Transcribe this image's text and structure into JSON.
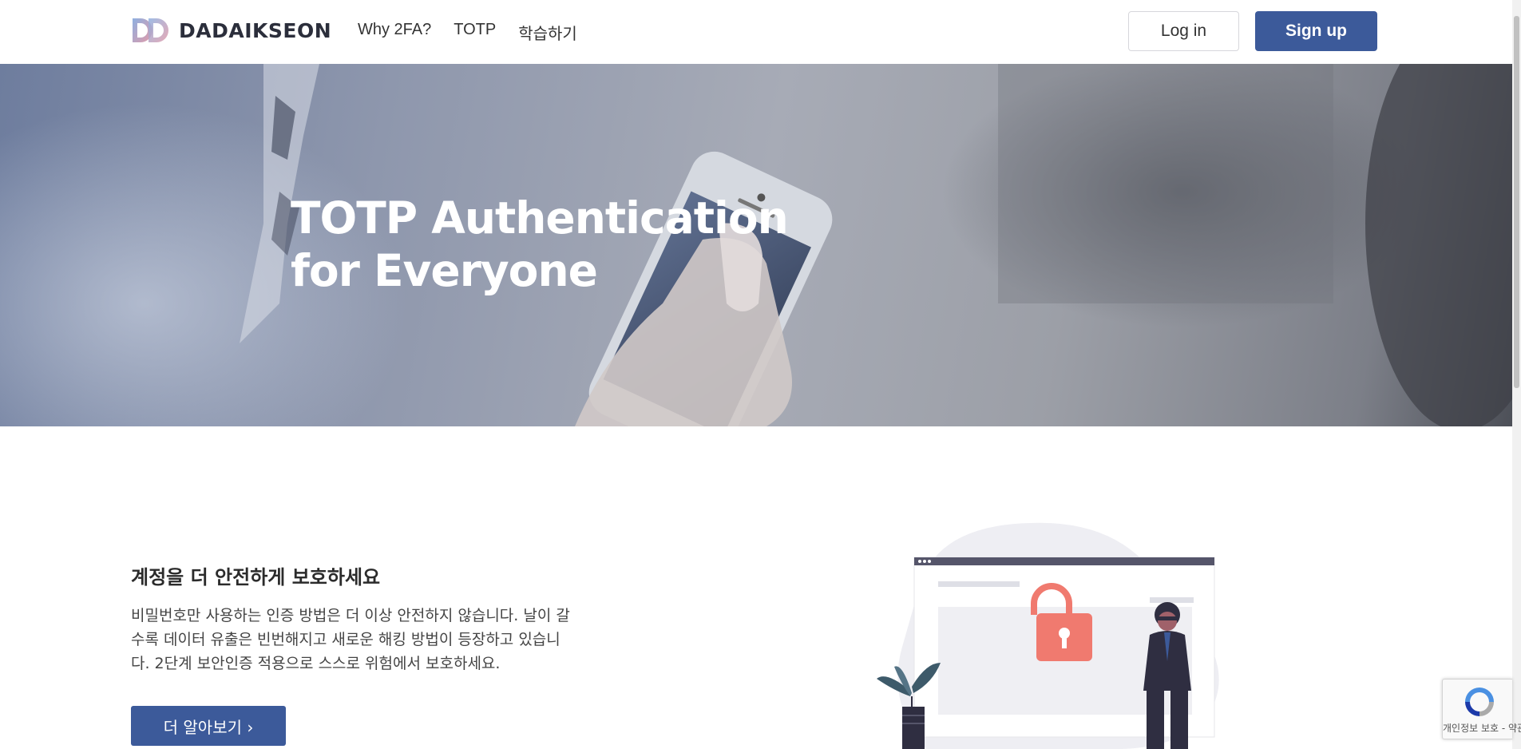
{
  "header": {
    "logo_text": "DADAIKSEON",
    "nav": [
      {
        "label": "Why 2FA?"
      },
      {
        "label": "TOTP"
      },
      {
        "label": "학습하기"
      }
    ],
    "login_label": "Log in",
    "signup_label": "Sign up"
  },
  "hero": {
    "title_line1": "TOTP Authentication",
    "title_line2": "for Everyone"
  },
  "section": {
    "title": "계정을 더 안전하게 보호하세요",
    "text": "비밀번호만 사용하는 인증 방법은 더 이상 안전하지 않습니다. 날이 갈수록 데이터 유출은 빈번해지고 새로운 해킹 방법이 등장하고 있습니다. 2단계 보안인증 적용으로 스스로 위험에서 보호하세요.",
    "button_label": "더 알아보기 ›"
  },
  "recaptcha": {
    "text": "개인정보 보호 - 약관"
  },
  "colors": {
    "primary": "#3c5a9a",
    "lock": "#f07a6f",
    "dark": "#2f2e41"
  }
}
